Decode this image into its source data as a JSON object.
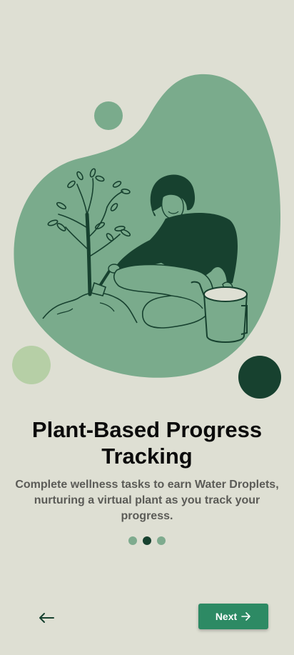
{
  "onboarding": {
    "title_line1": "Plant-Based Progress",
    "title_line2": "Tracking",
    "description": "Complete wellness tasks to earn Water Droplets, nurturing a virtual plant as you track your progress.",
    "pagination": {
      "total": 3,
      "active_index": 1
    },
    "back_icon": "arrow-left-icon",
    "next_label": "Next",
    "next_icon": "arrow-right-icon"
  },
  "colors": {
    "background": "#dedfd3",
    "blob": "#7aab8c",
    "dark_green": "#17412f",
    "light_green": "#b6cfa6",
    "button": "#2d8a64"
  }
}
